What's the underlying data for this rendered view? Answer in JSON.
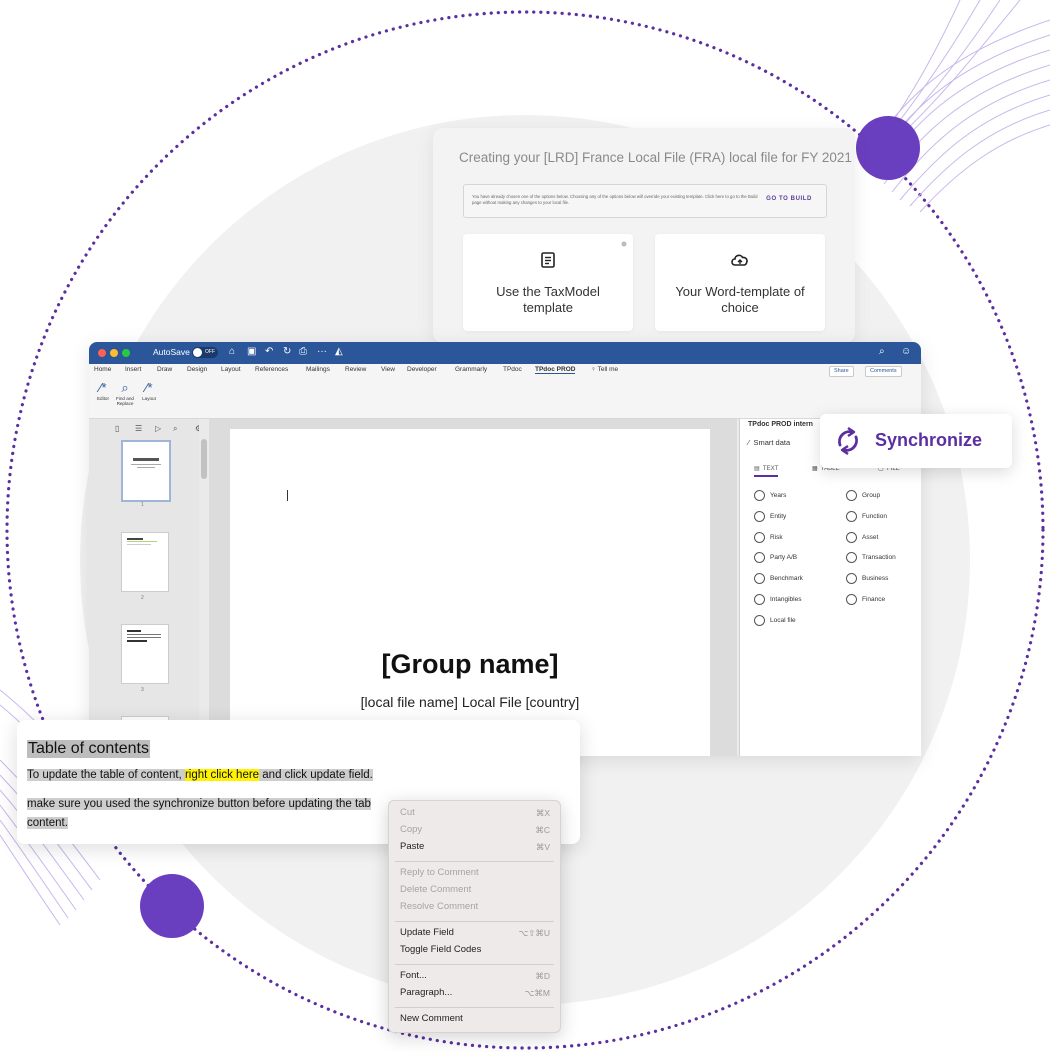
{
  "top_card": {
    "title": "Creating your [LRD] France Local File (FRA) local file for FY 2021",
    "notice": "You have already chosen one of the options below. Choosing any of the options below will override your existing template. Click here to go to the Build page without making any changes to your local file.",
    "go_to_build": "GO TO BUILD",
    "option_taxmodel": "Use the TaxModel template",
    "option_word": "Your Word-template of choice",
    "icons": [
      "document-icon",
      "cloud-upload-icon"
    ]
  },
  "word": {
    "autosave_label": "AutoSave",
    "autosave_state": "OFF",
    "menu": [
      "Home",
      "Insert",
      "Draw",
      "Design",
      "Layout",
      "References",
      "Mailings",
      "Review",
      "View",
      "Developer",
      "Grammarly",
      "TPdoc",
      "TPdoc PROD",
      "Tell me"
    ],
    "share": "Share",
    "comments": "Comments",
    "ribbon": {
      "editor": "Editor",
      "find_replace": "Find and Replace",
      "layout": "Layout"
    },
    "thumbnails": [
      "1",
      "2",
      "3"
    ],
    "page": {
      "group_name": "[Group name]",
      "local_file": "[local file name] Local File [country]"
    },
    "panel": {
      "title": "TPdoc PROD intern",
      "smart_data": "Smart data",
      "tabs": [
        "TEXT",
        "TABLE",
        "FILE"
      ],
      "options_left": [
        "Years",
        "Entity",
        "Risk",
        "Party A/B",
        "Benchmark",
        "Intangibles",
        "Local file"
      ],
      "options_right": [
        "Group",
        "Function",
        "Asset",
        "Transaction",
        "Business",
        "Finance"
      ]
    },
    "colors": {
      "titlebar": "#2b579a",
      "accent": "#5b2fa0"
    }
  },
  "sync": {
    "label": "Synchronize"
  },
  "toc": {
    "heading": "Table of contents",
    "line1_a": "To update the table of content, ",
    "line1_highlight": "right click here",
    "line1_b": " and click update field.",
    "line2": "make sure you used the synchronize button before updating the tab",
    "line2_end": "content."
  },
  "context_menu": {
    "items": [
      {
        "label": "Cut",
        "shortcut": "⌘X",
        "enabled": false
      },
      {
        "label": "Copy",
        "shortcut": "⌘C",
        "enabled": false
      },
      {
        "label": "Paste",
        "shortcut": "⌘V",
        "enabled": true
      },
      {
        "label": "Reply to Comment",
        "shortcut": "",
        "enabled": false
      },
      {
        "label": "Delete Comment",
        "shortcut": "",
        "enabled": false
      },
      {
        "label": "Resolve Comment",
        "shortcut": "",
        "enabled": false
      },
      {
        "label": "Update Field",
        "shortcut": "⌥⇧⌘U",
        "enabled": true
      },
      {
        "label": "Toggle Field Codes",
        "shortcut": "",
        "enabled": true
      },
      {
        "label": "Font...",
        "shortcut": "⌘D",
        "enabled": true
      },
      {
        "label": "Paragraph...",
        "shortcut": "⌥⌘M",
        "enabled": true
      },
      {
        "label": "New Comment",
        "shortcut": "",
        "enabled": true
      }
    ]
  },
  "brand_colors": {
    "purple": "#6a3fbf",
    "dots": "#5b2fa0"
  }
}
